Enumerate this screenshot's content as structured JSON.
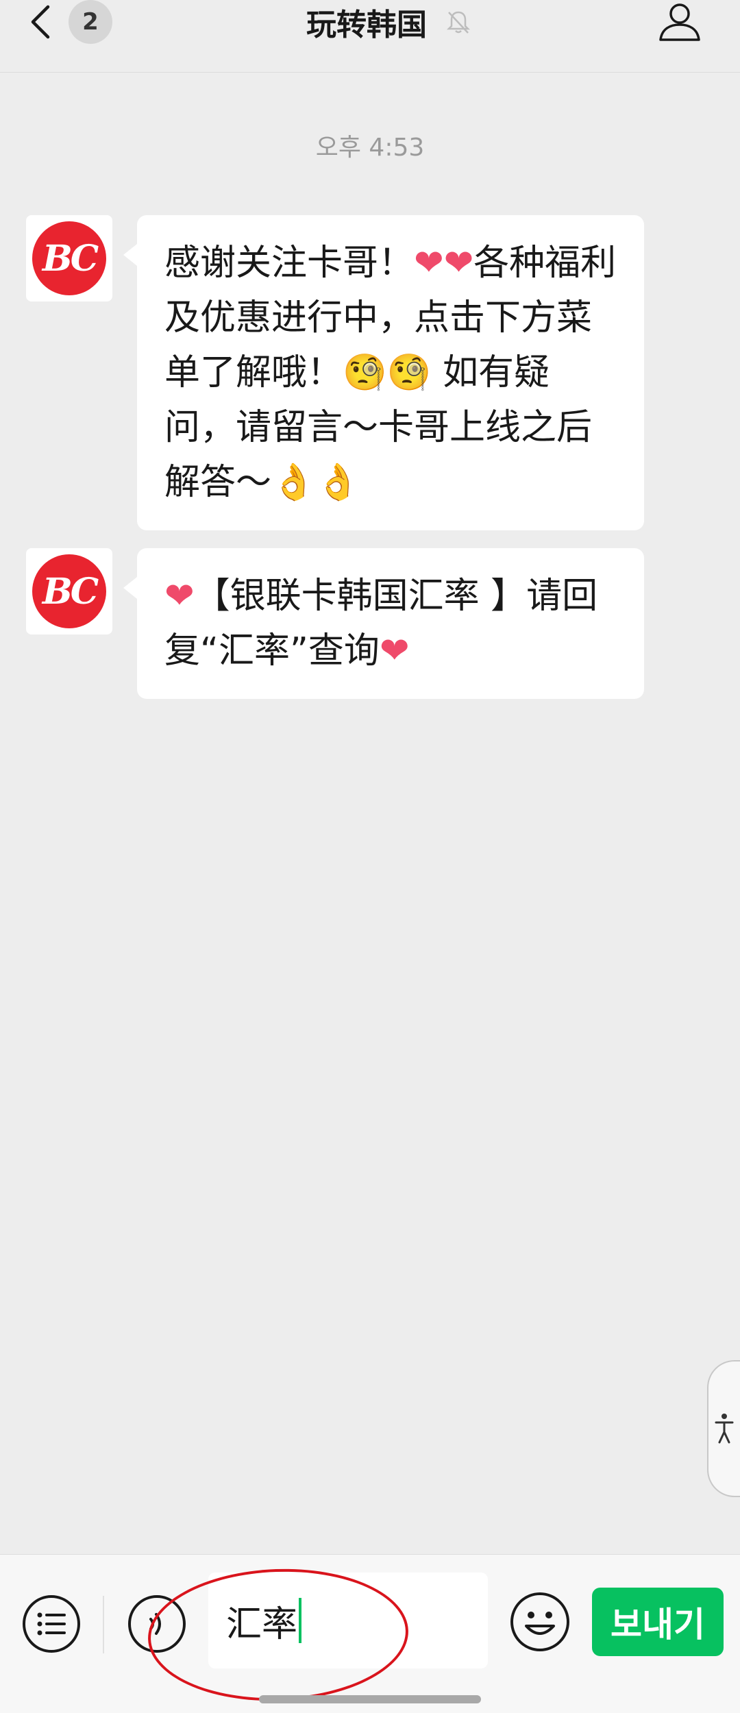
{
  "header": {
    "unread_count": "2",
    "title": "玩转韩国"
  },
  "chat": {
    "timestamp": "오후 4:53",
    "avatar_text": "BC",
    "messages": [
      {
        "text_parts": [
          "感谢关注卡哥！",
          "❤❤",
          "各种福利及优惠进行中，点击下方菜单了解哦！",
          "🧐🧐",
          " 如有疑问，请留言～卡哥上线之后解答～",
          "👌👌"
        ]
      },
      {
        "text_parts": [
          "❤",
          "【银联卡韩国汇率 】请回复“汇率”查询",
          "❤"
        ]
      }
    ]
  },
  "input_bar": {
    "input_value": "汇率",
    "send_label": "보내기"
  },
  "colors": {
    "accent_green": "#07c160",
    "background": "#ededed",
    "annotation_red": "#d9141c",
    "avatar_red": "#e8242f"
  },
  "icons": {
    "back": "chevron-left-icon",
    "mute": "bell-off-icon",
    "profile": "person-icon",
    "menu": "list-icon",
    "voice": "voice-icon",
    "emoji": "smiley-icon",
    "accessibility": "accessibility-icon"
  }
}
